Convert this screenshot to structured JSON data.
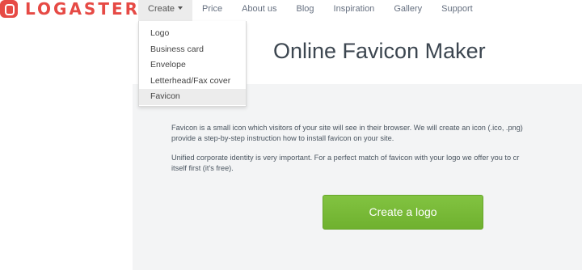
{
  "brand": {
    "name": "LOGASTER",
    "color": "#e64a45"
  },
  "nav": {
    "items": [
      {
        "label": "Create",
        "has_caret": true,
        "active": true
      },
      {
        "label": "Price"
      },
      {
        "label": "About us"
      },
      {
        "label": "Blog"
      },
      {
        "label": "Inspiration"
      },
      {
        "label": "Gallery"
      },
      {
        "label": "Support"
      }
    ]
  },
  "dropdown": {
    "items": [
      {
        "label": "Logo"
      },
      {
        "label": "Business card"
      },
      {
        "label": "Envelope"
      },
      {
        "label": "Letterhead/Fax cover"
      },
      {
        "label": "Favicon",
        "selected": true
      }
    ]
  },
  "main": {
    "title": "Online Favicon Maker",
    "paragraph1": [
      "Favicon is a small icon which visitors of your site will see in their browser. We will create an icon (.ico, .png)",
      "provide a step-by-step instruction how to install favicon on your site."
    ],
    "paragraph2": [
      "Unified corporate identity is very important. For a perfect match of favicon with your logo we offer you to cr",
      "itself first (it's free)."
    ],
    "cta_label": "Create a logo",
    "cta_color": "#76b836"
  }
}
